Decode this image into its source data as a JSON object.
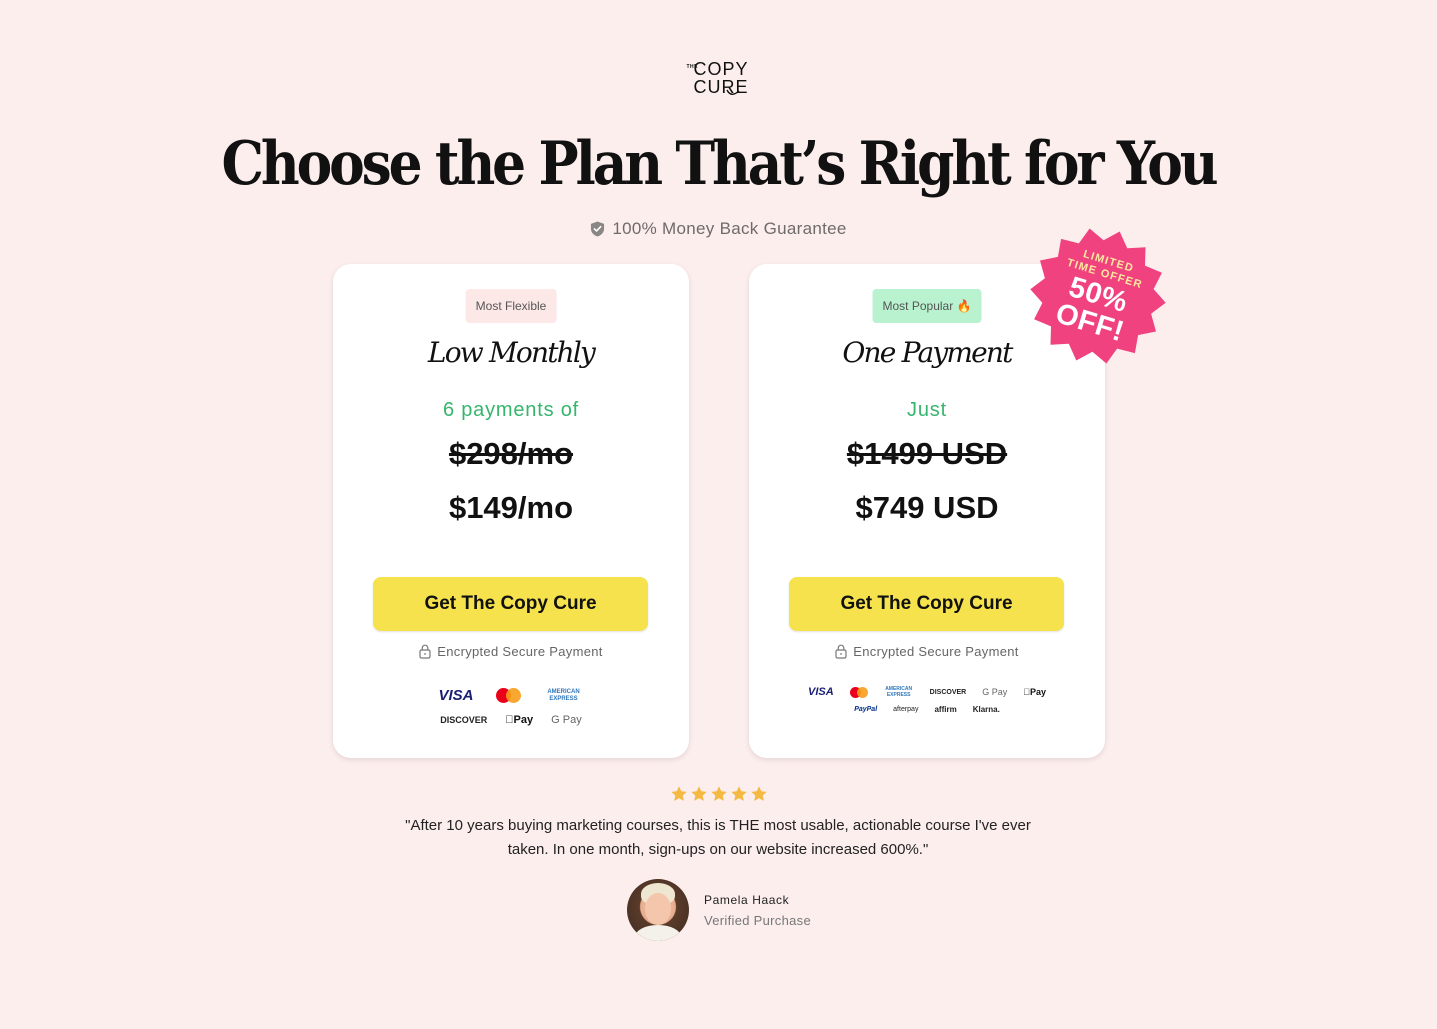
{
  "brand": {
    "logo_small": "THE",
    "logo_line1": "COPY",
    "logo_line2": "CURE"
  },
  "header": {
    "title": "Choose the Plan That’s Right for You",
    "guarantee": "100% Money Back Guarantee"
  },
  "promo": {
    "line1": "LIMITED",
    "line2": "TIME OFFER",
    "line3": "50%",
    "line4": "OFF!"
  },
  "plans": [
    {
      "badge": "Most Flexible",
      "name": "Low Monthly",
      "pre_price": "6 payments of",
      "old_price": "$298/mo",
      "price": "$149/mo",
      "cta": "Get The Copy Cure",
      "secure": "Encrypted Secure Payment",
      "payment_methods": [
        "VISA",
        "mastercard",
        "AMERICAN EXPRESS",
        "DISCOVER",
        "Pay",
        "G Pay"
      ]
    },
    {
      "badge": "Most Popular 🔥",
      "name": "One Payment",
      "pre_price": "Just",
      "old_price": "$1499 USD",
      "price": "$749 USD",
      "cta": "Get The Copy Cure",
      "secure": "Encrypted Secure Payment",
      "payment_methods": [
        "VISA",
        "mastercard",
        "AMERICAN EXPRESS",
        "DISCOVER",
        "G Pay",
        "Pay",
        "PayPal",
        "afterpay",
        "affirm",
        "Klarna."
      ]
    }
  ],
  "testimonial": {
    "rating": 5,
    "quote": "\"After 10 years buying marketing courses, this is THE most usable, actionable course I've ever taken. In one month, sign-ups on our website increased 600%.\"",
    "name": "Pamela Haack",
    "status": "Verified Purchase"
  },
  "colors": {
    "background": "#fdeeee",
    "cta": "#f5e24d",
    "accent_green": "#36b56c",
    "badge_pink": "#fde8e8",
    "badge_green": "#b8f2cf",
    "burst": "#f0427e",
    "star": "#f4b942"
  }
}
